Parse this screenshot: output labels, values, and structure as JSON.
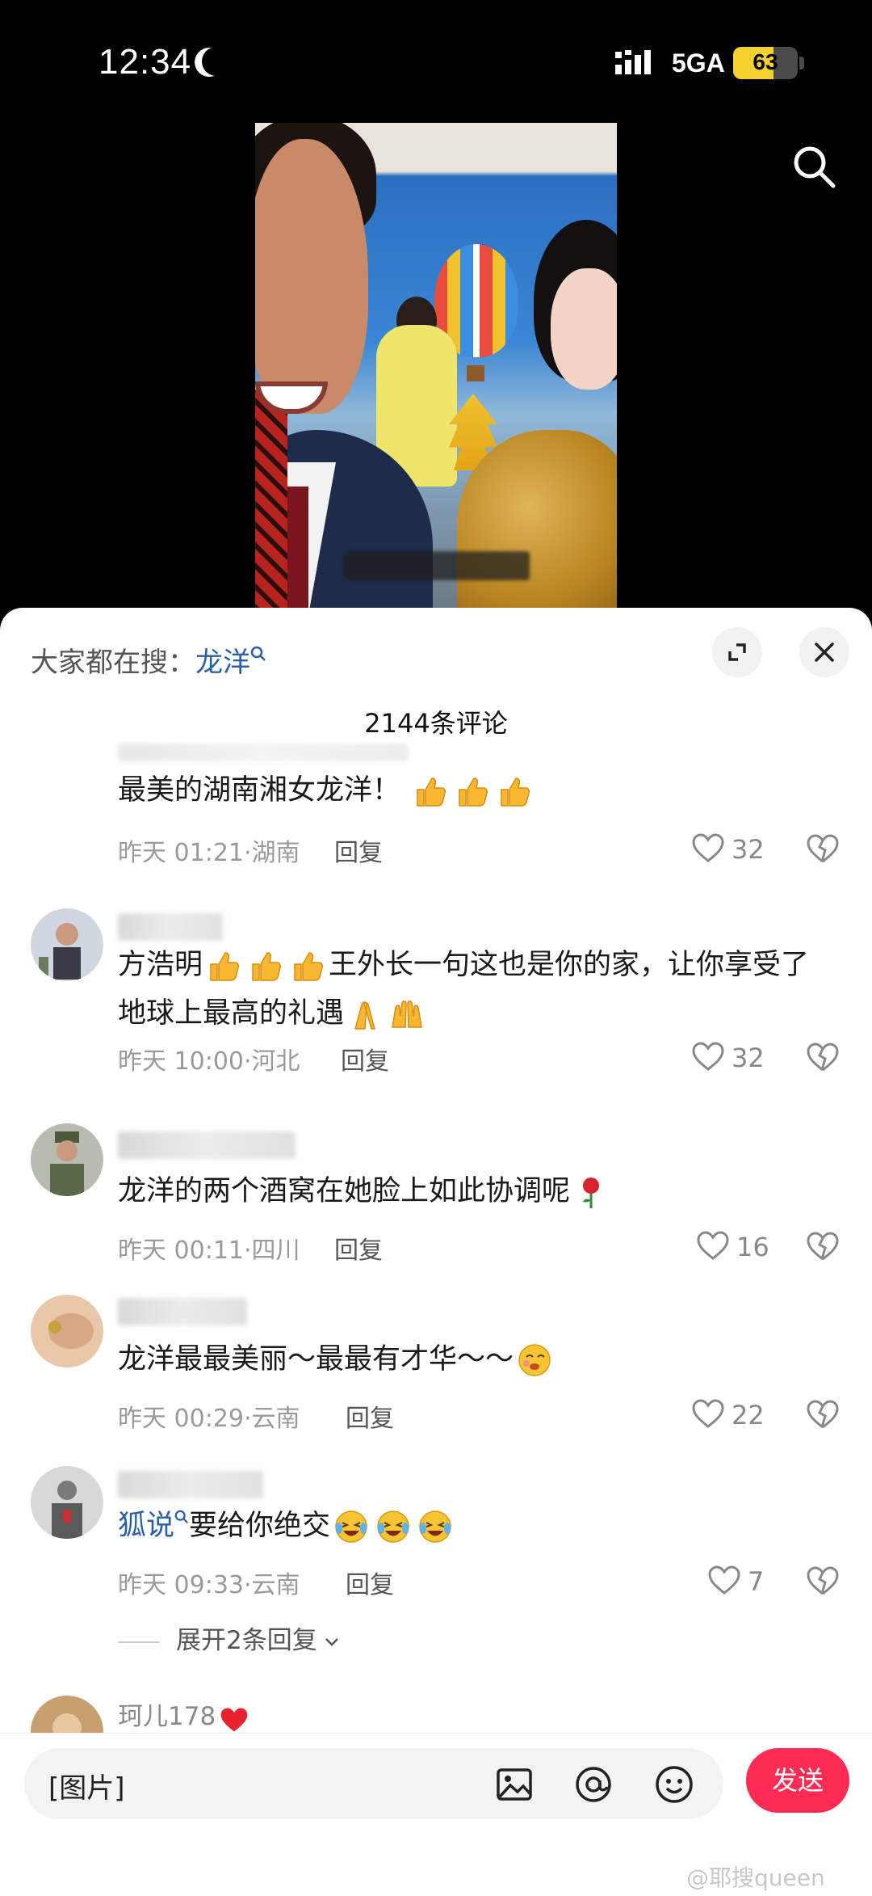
{
  "status_bar": {
    "time": "12:34",
    "network": "5GA",
    "battery": "63",
    "battery_level": 0.63
  },
  "hot_search": {
    "prefix": "大家都在搜：",
    "term": "龙洋"
  },
  "comment_count": "2144条评论",
  "comments": [
    {
      "text": "最美的湖南湘女龙洋！",
      "time": "昨天 01:21",
      "location": "湖南",
      "reply": "回复",
      "likes": "32",
      "emojis": [
        "thumbs-up",
        "thumbs-up",
        "thumbs-up"
      ]
    },
    {
      "text_a": "方浩明",
      "text_b": "王外长一句这也是你的家，让你享受了",
      "text_c": "地球上最高的礼遇",
      "time": "昨天 10:00",
      "location": "河北",
      "reply": "回复",
      "likes": "32"
    },
    {
      "text": "龙洋的两个酒窝在她脸上如此协调呢",
      "time": "昨天 00:11",
      "location": "四川",
      "reply": "回复",
      "likes": "16"
    },
    {
      "text": "龙洋最最美丽～最最有才华～～",
      "time": "昨天 00:29",
      "location": "云南",
      "reply": "回复",
      "likes": "22"
    },
    {
      "author_ref": "狐说",
      "text": "要给你绝交",
      "time": "昨天 09:33",
      "location": "云南",
      "reply": "回复",
      "likes": "7",
      "expand": "展开2条回复"
    },
    {
      "username": "珂儿178"
    }
  ],
  "input": {
    "value": "[图片]",
    "send": "发送"
  },
  "watermark": "@耶搜queen",
  "colors": {
    "accent": "#fe2c55",
    "link": "#2a5ea8"
  }
}
